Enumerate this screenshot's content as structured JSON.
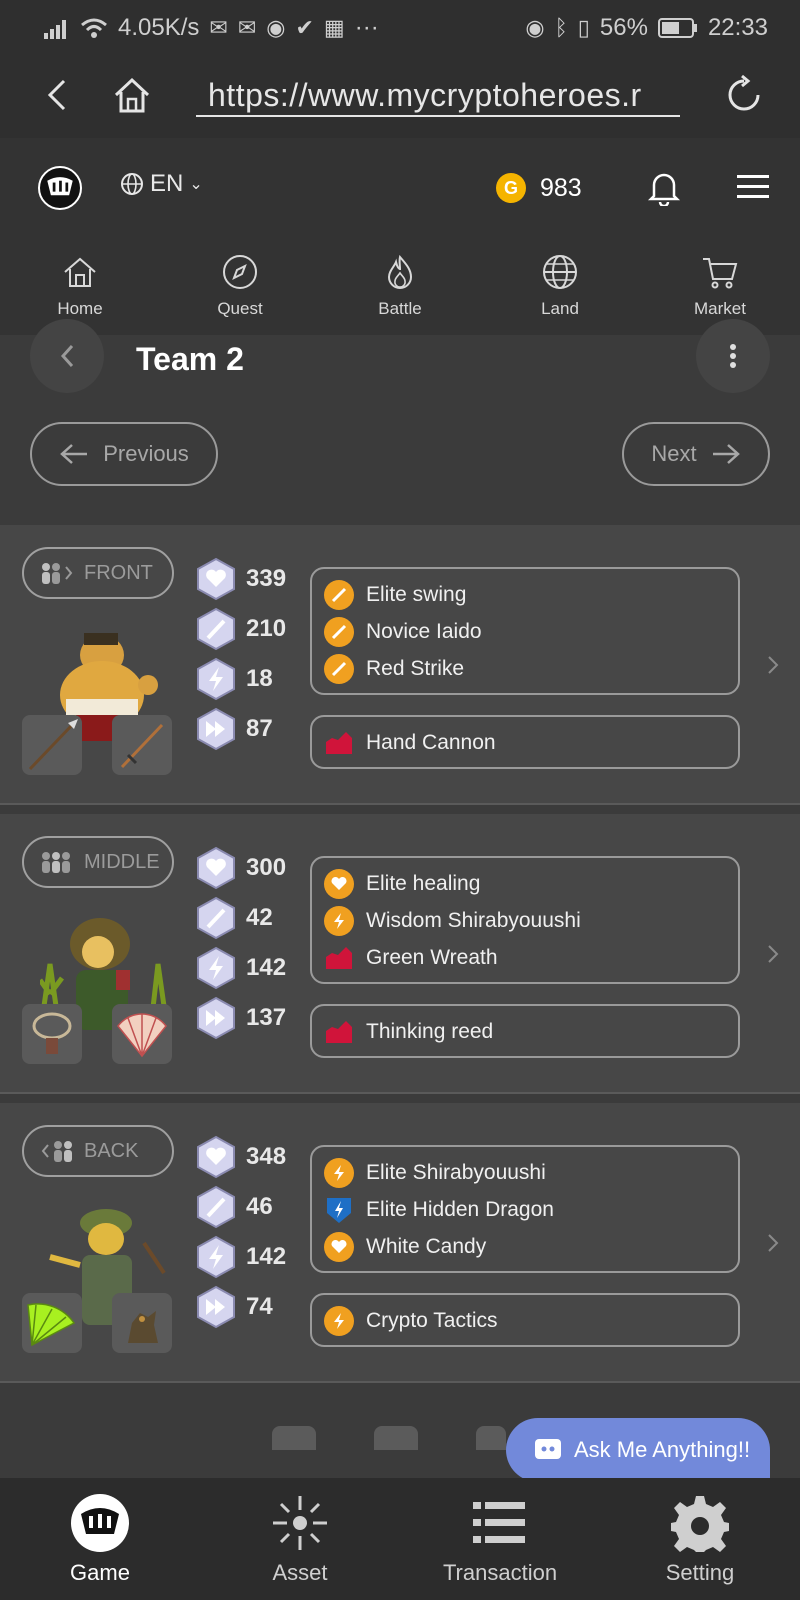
{
  "statusbar": {
    "speed": "4.05K/s",
    "dots": "···",
    "battery": "56%",
    "time": "22:33"
  },
  "browser": {
    "url": "https://www.mycryptoheroes.r"
  },
  "header": {
    "language": "EN",
    "coin_symbol": "G",
    "coin_amount": "983"
  },
  "nav": [
    {
      "label": "Home",
      "icon": "home-icon"
    },
    {
      "label": "Quest",
      "icon": "compass-icon"
    },
    {
      "label": "Battle",
      "icon": "flame-icon"
    },
    {
      "label": "Land",
      "icon": "globe-icon"
    },
    {
      "label": "Market",
      "icon": "cart-icon"
    }
  ],
  "team": {
    "title": "Team 2",
    "prev_label": "Previous",
    "next_label": "Next"
  },
  "heroes": [
    {
      "position": "FRONT",
      "stats": {
        "hp": "339",
        "phy": "210",
        "int": "18",
        "agi": "87"
      },
      "skills": [
        {
          "name": "Elite swing",
          "icon": "sword-icon",
          "color": "#f0a020"
        },
        {
          "name": "Novice Iaido",
          "icon": "sword-icon",
          "color": "#f0a020"
        },
        {
          "name": "Red Strike",
          "icon": "sword-icon",
          "color": "#f0a020"
        }
      ],
      "extension": {
        "name": "Hand Cannon",
        "icon": "extension-icon",
        "color": "#d0143a"
      }
    },
    {
      "position": "MIDDLE",
      "stats": {
        "hp": "300",
        "phy": "42",
        "int": "142",
        "agi": "137"
      },
      "skills": [
        {
          "name": "Elite healing",
          "icon": "heart-icon",
          "color": "#f0a020"
        },
        {
          "name": "Wisdom Shirabyouushi",
          "icon": "lightning-icon",
          "color": "#f0a020"
        },
        {
          "name": "Green Wreath",
          "icon": "extension-icon",
          "color": "#d0143a"
        }
      ],
      "extension": {
        "name": "Thinking reed",
        "icon": "extension-icon",
        "color": "#d0143a"
      }
    },
    {
      "position": "BACK",
      "stats": {
        "hp": "348",
        "phy": "46",
        "int": "142",
        "agi": "74"
      },
      "skills": [
        {
          "name": "Elite Shirabyouushi",
          "icon": "lightning-icon",
          "color": "#f0a020"
        },
        {
          "name": "Elite Hidden Dragon",
          "icon": "shield-icon",
          "color": "#1e6fc6"
        },
        {
          "name": "White Candy",
          "icon": "heart-icon",
          "color": "#f0a020"
        }
      ],
      "extension": {
        "name": "Crypto Tactics",
        "icon": "lightning-icon",
        "color": "#f0a020"
      }
    }
  ],
  "footer": {
    "ama_label": "Ask Me Anything!!"
  },
  "tabs": [
    {
      "label": "Game",
      "icon": "game-logo-icon"
    },
    {
      "label": "Asset",
      "icon": "asset-icon"
    },
    {
      "label": "Transaction",
      "icon": "list-icon"
    },
    {
      "label": "Setting",
      "icon": "gear-icon"
    }
  ]
}
